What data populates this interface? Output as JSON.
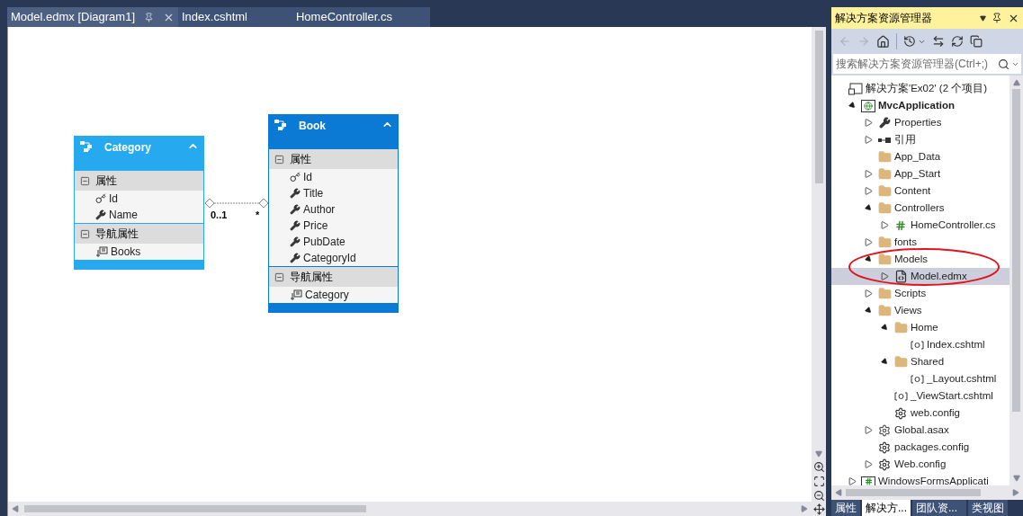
{
  "editor_tabs": [
    {
      "label": "Model.edmx [Diagram1]",
      "selected": true
    },
    {
      "label": "Index.cshtml",
      "selected": false
    },
    {
      "label": "HomeController.cs",
      "selected": false
    }
  ],
  "diagram": {
    "entities": [
      {
        "name": "Category",
        "selected": false,
        "sections": [
          {
            "title": "属性",
            "expanded": true,
            "items": [
              {
                "name": "Id",
                "kind": "key"
              },
              {
                "name": "Name",
                "kind": "property"
              }
            ]
          },
          {
            "title": "导航属性",
            "expanded": true,
            "items": [
              {
                "name": "Books",
                "kind": "navigation"
              }
            ]
          }
        ]
      },
      {
        "name": "Book",
        "selected": true,
        "sections": [
          {
            "title": "属性",
            "expanded": true,
            "items": [
              {
                "name": "Id",
                "kind": "key"
              },
              {
                "name": "Title",
                "kind": "property"
              },
              {
                "name": "Author",
                "kind": "property"
              },
              {
                "name": "Price",
                "kind": "property"
              },
              {
                "name": "PubDate",
                "kind": "property"
              },
              {
                "name": "CategoryId",
                "kind": "property"
              }
            ]
          },
          {
            "title": "导航属性",
            "expanded": true,
            "items": [
              {
                "name": "Category",
                "kind": "navigation"
              }
            ]
          }
        ]
      }
    ],
    "association": {
      "source_multiplicity": "0..1",
      "target_multiplicity": "*"
    }
  },
  "solution_explorer": {
    "title": "解决方案资源管理器",
    "search": {
      "placeholder": "搜索解决方案资源管理器(Ctrl+;)"
    },
    "tree": [
      {
        "label": "解决方案'Ex02' (2 个项目)",
        "kind": "solution",
        "children": [
          {
            "label": "MvcApplication",
            "kind": "project",
            "expanded": true,
            "children": [
              {
                "label": "Properties",
                "kind": "wrench",
                "expanded": false
              },
              {
                "label": "引用",
                "kind": "references",
                "expanded": false
              },
              {
                "label": "App_Data",
                "kind": "folder"
              },
              {
                "label": "App_Start",
                "kind": "folder",
                "expanded": false
              },
              {
                "label": "Content",
                "kind": "folder",
                "expanded": false
              },
              {
                "label": "Controllers",
                "kind": "folder",
                "expanded": true,
                "children": [
                  {
                    "label": "HomeController.cs",
                    "kind": "csharp",
                    "expanded": false
                  }
                ]
              },
              {
                "label": "fonts",
                "kind": "folder",
                "expanded": false
              },
              {
                "label": "Models",
                "kind": "folder",
                "expanded": true,
                "children": [
                  {
                    "label": "Model.edmx",
                    "kind": "edmx",
                    "expanded": false,
                    "selected": true
                  }
                ]
              },
              {
                "label": "Scripts",
                "kind": "folder",
                "expanded": false
              },
              {
                "label": "Views",
                "kind": "folder",
                "expanded": true,
                "children": [
                  {
                    "label": "Home",
                    "kind": "folder",
                    "expanded": true,
                    "children": [
                      {
                        "label": "Index.cshtml",
                        "kind": "razor"
                      }
                    ]
                  },
                  {
                    "label": "Shared",
                    "kind": "folder",
                    "expanded": true,
                    "children": [
                      {
                        "label": "_Layout.cshtml",
                        "kind": "razor"
                      }
                    ]
                  },
                  {
                    "label": "_ViewStart.cshtml",
                    "kind": "razor"
                  },
                  {
                    "label": "web.config",
                    "kind": "config"
                  }
                ]
              },
              {
                "label": "Global.asax",
                "kind": "asax",
                "expanded": false
              },
              {
                "label": "packages.config",
                "kind": "config"
              },
              {
                "label": "Web.config",
                "kind": "config",
                "expanded": false
              }
            ]
          },
          {
            "label": "WindowsFormsApplicati",
            "kind": "csproj",
            "expanded": false
          }
        ]
      }
    ],
    "bottom_tabs": [
      {
        "label": "属性",
        "selected": false
      },
      {
        "label": "解决方...",
        "selected": true
      },
      {
        "label": "团队资...",
        "selected": false
      },
      {
        "label": "类视图",
        "selected": false
      }
    ]
  }
}
